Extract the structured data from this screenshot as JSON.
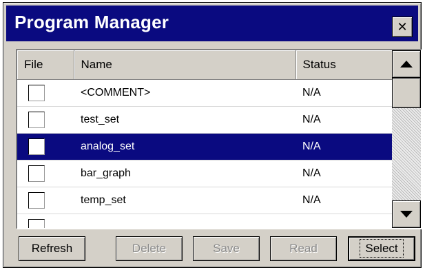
{
  "window": {
    "title": "Program Manager",
    "close_symbol": "✕"
  },
  "table": {
    "columns": [
      "File",
      "Name",
      "Status"
    ],
    "rows": [
      {
        "name": "<COMMENT>",
        "status": "N/A",
        "checked": false,
        "selected": false
      },
      {
        "name": "test_set",
        "status": "N/A",
        "checked": false,
        "selected": false
      },
      {
        "name": "analog_set",
        "status": "N/A",
        "checked": false,
        "selected": true
      },
      {
        "name": "bar_graph",
        "status": "N/A",
        "checked": false,
        "selected": false
      },
      {
        "name": "temp_set",
        "status": "N/A",
        "checked": false,
        "selected": false
      },
      {
        "name": "",
        "status": "",
        "checked": false,
        "selected": false
      }
    ]
  },
  "buttons": {
    "refresh": "Refresh",
    "delete": "Delete",
    "save": "Save",
    "read": "Read",
    "select": "Select"
  },
  "icons": {
    "close": "close-icon",
    "scroll_up": "triangle-up-icon",
    "scroll_down": "triangle-down-icon"
  },
  "colors": {
    "titlebar": "#0a0a80",
    "selection": "#0a0a80",
    "face": "#d4d0c8"
  }
}
